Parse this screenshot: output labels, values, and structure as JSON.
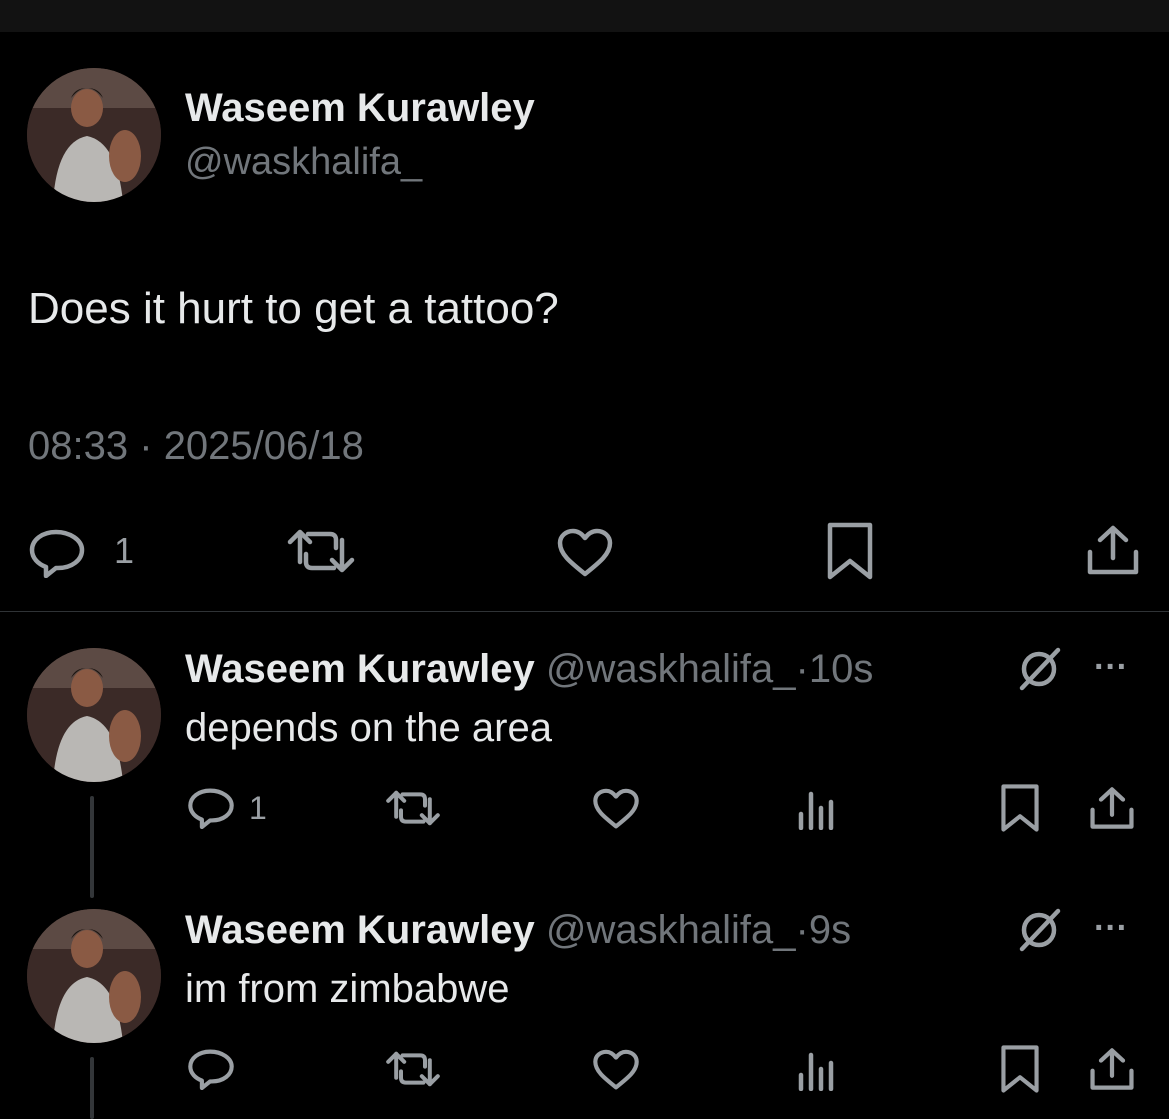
{
  "main_tweet": {
    "author_name": "Waseem Kurawley",
    "handle": "@waskhalifa_",
    "text": "Does it hurt to get a tattoo?",
    "time": "08:33",
    "separator": "·",
    "date": "2025/06/18",
    "actions": {
      "reply_count": "1"
    }
  },
  "replies": [
    {
      "author_name": "Waseem Kurawley",
      "handle": "@waskhalifa_",
      "separator": "·",
      "age": "10s",
      "text": "depends on the area",
      "reply_count": "1",
      "more_label": "···"
    },
    {
      "author_name": "Waseem Kurawley",
      "handle": "@waskhalifa_",
      "separator": "·",
      "age": "9s",
      "text": "im from zimbabwe",
      "reply_count": "",
      "more_label": "···"
    }
  ],
  "colors": {
    "background": "#000000",
    "text": "#e7e9ea",
    "secondary": "#71767b",
    "icon": "#9a9fa4"
  }
}
